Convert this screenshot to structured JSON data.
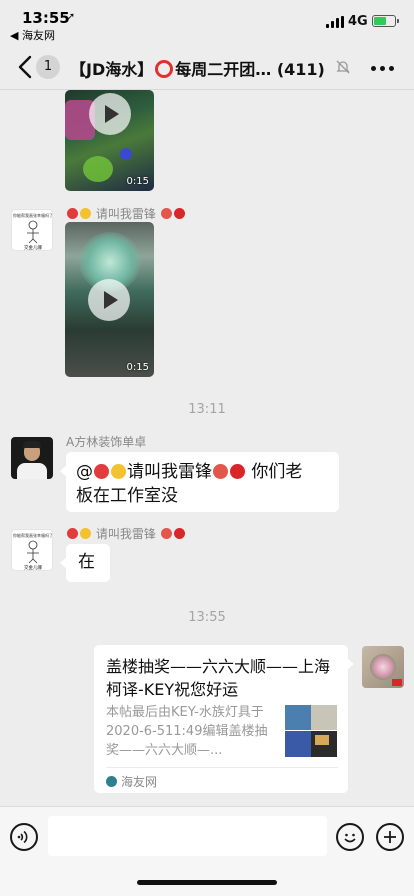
{
  "status_bar": {
    "time": "13:55",
    "location_arrow": "➚",
    "back_app": "◀ 海友网",
    "network": "4G",
    "battery_level": 0.6
  },
  "nav": {
    "unread_count": "1",
    "title_left": "【JD海水】",
    "title_right": "每周二开团…",
    "member_count": "(411)"
  },
  "messages": {
    "video1_duration": "0:15",
    "video2_sender": "请叫我雷锋",
    "video2_duration": "0:15",
    "time1": "13:11",
    "msg1_sender": "A方林装饰单卓",
    "msg1_text": "@请叫我雷锋 你们老板在工作室没",
    "msg1_line1_pre": "@",
    "msg1_line1_post": "请叫我雷锋",
    "msg1_line1_tail": "你们老",
    "msg1_line2": "板在工作室没",
    "msg2_sender": "请叫我雷锋",
    "msg2_text": "在",
    "time2": "13:55",
    "avatar_sketch_caption": "交金儿哪",
    "avatar_sketch_header": "你能帮我画张幸福吗了"
  },
  "link_card": {
    "title": "盖楼抽奖——六六大顺——上海柯译-KEY祝您好运",
    "description": "本帖最后由KEY-水族灯具于2020-6-511:49编辑盖楼抽奖——六六大顺—...",
    "source": "海友网"
  },
  "colors": {
    "background": "#ededed",
    "bubble": "#ffffff",
    "accent_red": "#e0312e"
  }
}
